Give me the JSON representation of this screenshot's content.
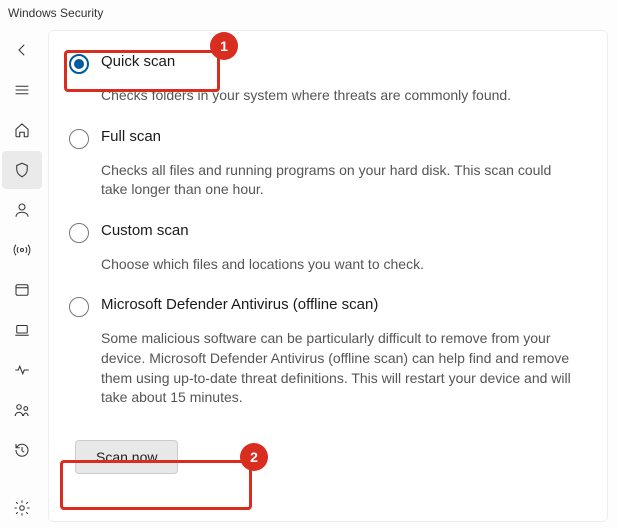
{
  "app_title": "Windows Security",
  "annotations": {
    "badge1": "1",
    "badge2": "2"
  },
  "options": {
    "quick": {
      "label": "Quick scan",
      "desc": "Checks folders in your system where threats are commonly found."
    },
    "full": {
      "label": "Full scan",
      "desc": "Checks all files and running programs on your hard disk. This scan could take longer than one hour."
    },
    "custom": {
      "label": "Custom scan",
      "desc": "Choose which files and locations you want to check."
    },
    "offline": {
      "label": "Microsoft Defender Antivirus (offline scan)",
      "desc": "Some malicious software can be particularly difficult to remove from your device. Microsoft Defender Antivirus (offline scan) can help find and remove them using up-to-date threat definitions. This will restart your device and will take about 15 minutes."
    }
  },
  "scan_button": "Scan now"
}
